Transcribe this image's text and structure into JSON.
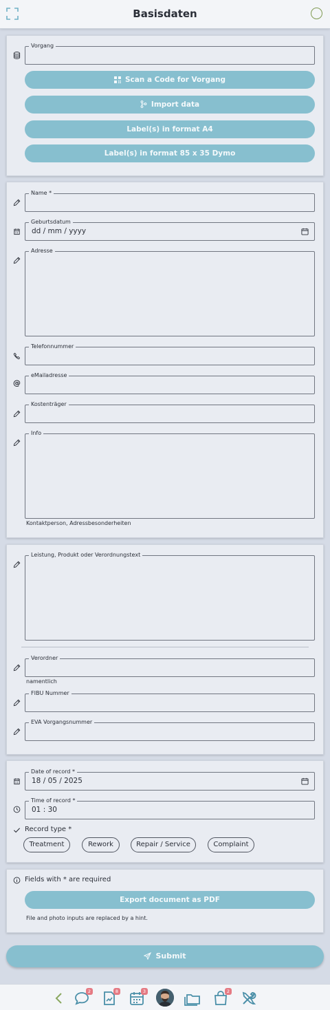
{
  "header": {
    "title": "Basisdaten"
  },
  "vorgang": {
    "label": "Vorgang",
    "value": "",
    "buttons": {
      "scan": "Scan a Code for Vorgang",
      "import": "Import data",
      "label_a4": "Label(s) in format A4",
      "label_dymo": "Label(s) in format 85 x 35 Dymo"
    }
  },
  "person": {
    "name_label": "Name *",
    "geburtsdatum_label": "Geburtsdatum",
    "geburtsdatum_value": "dd / mm / yyyy",
    "adresse_label": "Adresse",
    "telefon_label": "Telefonnummer",
    "email_label": "eMailadresse",
    "kostentraeger_label": "Kostenträger",
    "info_label": "Info",
    "info_hint": "Kontaktperson, Adressbesonderheiten"
  },
  "leistung": {
    "text_label": "Leistung, Produkt oder Verordnungstext",
    "verordner_label": "Verordner",
    "verordner_hint": "namentlich",
    "fibu_label": "FIBU Nummer",
    "eva_label": "EVA Vorgangsnummer"
  },
  "record": {
    "date_label": "Date of record *",
    "date_value": "18 / 05 / 2025",
    "time_label": "Time of record *",
    "time_value": "01 : 30",
    "type_label": "Record type *",
    "types": [
      "Treatment",
      "Rework",
      "Repair / Service",
      "Complaint"
    ]
  },
  "export": {
    "required_note": "Fields with * are required",
    "pdf_button": "Export document as PDF",
    "hint": "File and photo inputs are replaced by a hint."
  },
  "submit": {
    "label": "Submit"
  },
  "bottom_nav": {
    "badges": {
      "chat": "2",
      "document": "8",
      "calendar": "3",
      "bag": "2"
    }
  },
  "colors": {
    "accent": "#87bfcf",
    "background": "#d5dbe6",
    "card": "#e9ecf2",
    "badge": "#e57a83"
  }
}
